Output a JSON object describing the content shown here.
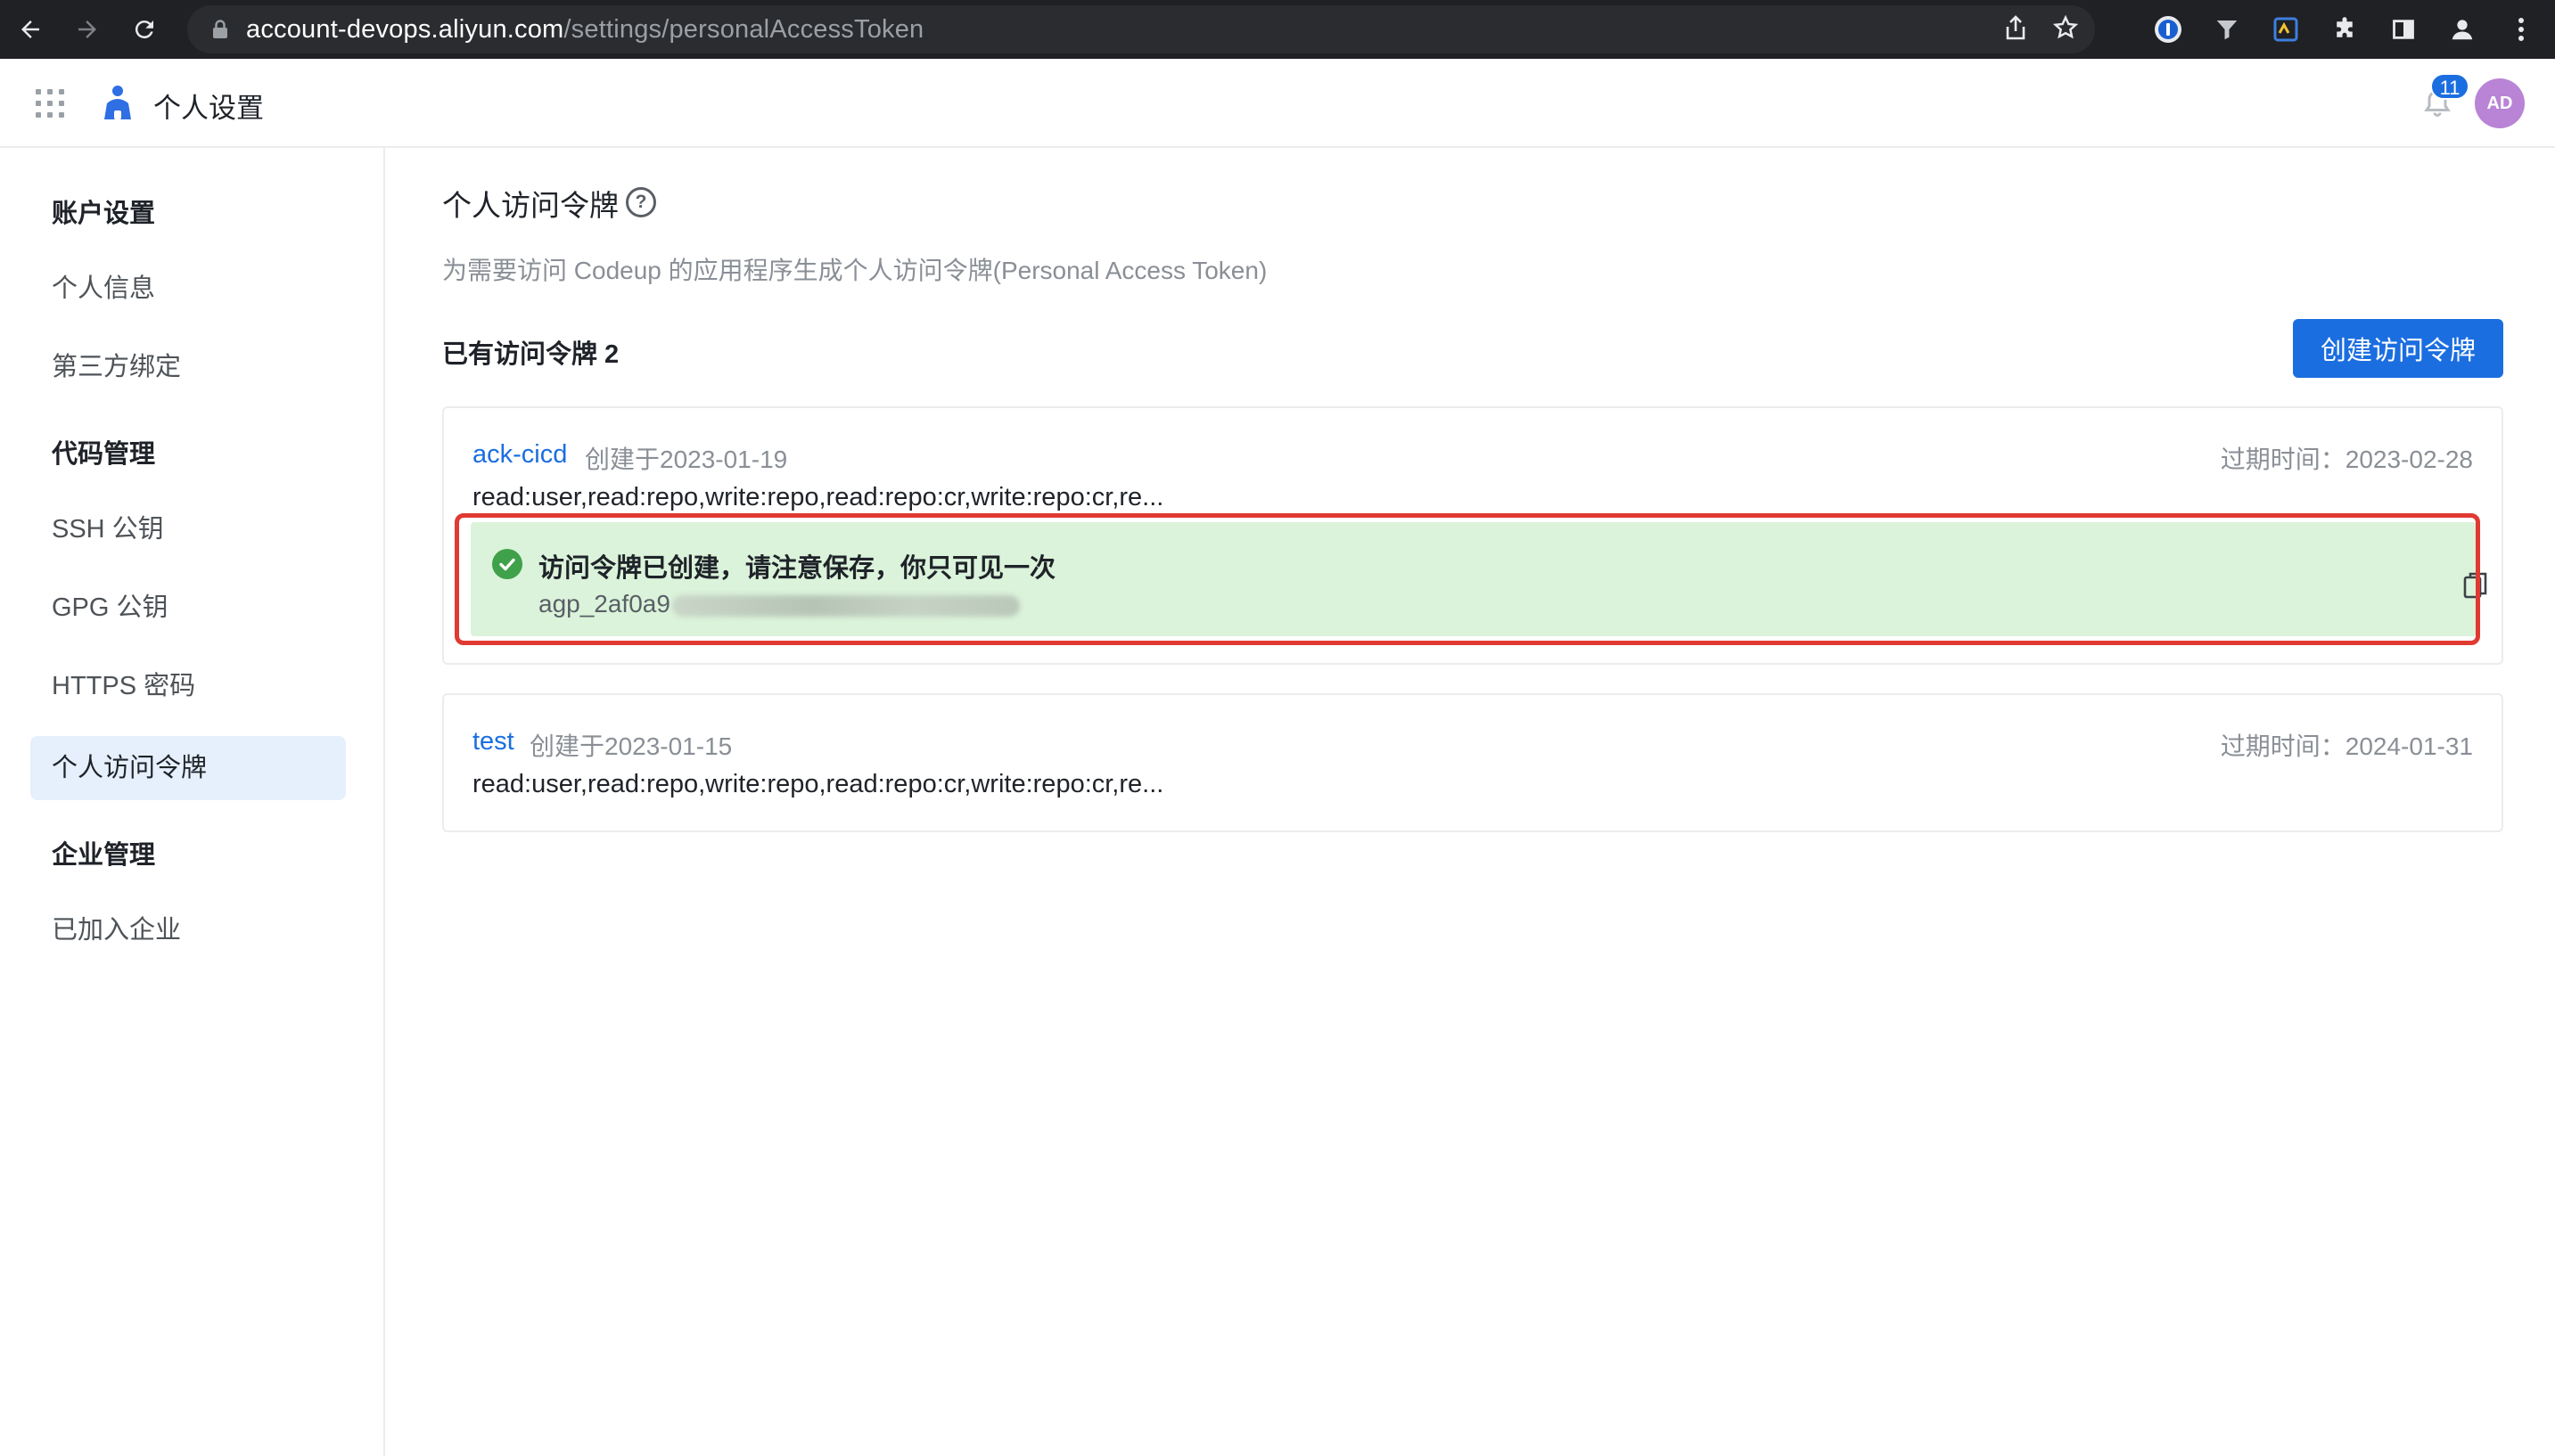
{
  "browser": {
    "url_host": "account-devops.aliyun.com",
    "url_path": "/settings/personalAccessToken"
  },
  "header": {
    "title": "个人设置",
    "notification_count": "11",
    "avatar_initials": "AD"
  },
  "sidebar": {
    "groups": [
      {
        "label": "账户设置",
        "items": [
          "个人信息",
          "第三方绑定"
        ]
      },
      {
        "label": "代码管理",
        "items": [
          "SSH 公钥",
          "GPG 公钥",
          "HTTPS 密码",
          "个人访问令牌"
        ]
      },
      {
        "label": "企业管理",
        "items": [
          "已加入企业"
        ]
      }
    ],
    "active_item": "个人访问令牌"
  },
  "main": {
    "title": "个人访问令牌",
    "description": "为需要访问 Codeup 的应用程序生成个人访问令牌(Personal Access Token)",
    "count_label": "已有访问令牌 2",
    "create_button": "创建访问令牌",
    "tokens": [
      {
        "name": "ack-cicd",
        "created": "创建于2023-01-19",
        "expire": "过期时间：2023-02-28",
        "scopes": "read:user,read:repo,write:repo,read:repo:cr,write:repo:cr,re...",
        "success_message": "访问令牌已创建，请注意保存，你只可见一次",
        "token_prefix": "agp_2af0a9"
      },
      {
        "name": "test",
        "created": "创建于2023-01-15",
        "expire": "过期时间：2024-01-31",
        "scopes": "read:user,read:repo,write:repo,read:repo:cr,write:repo:cr,re..."
      }
    ]
  },
  "colors": {
    "primary": "#1b6ee0",
    "success_bg": "#dbf3da",
    "success_icon": "#3fa14a",
    "highlight_outline": "#e03a32",
    "sidebar_active_bg": "#e6f0fc"
  }
}
